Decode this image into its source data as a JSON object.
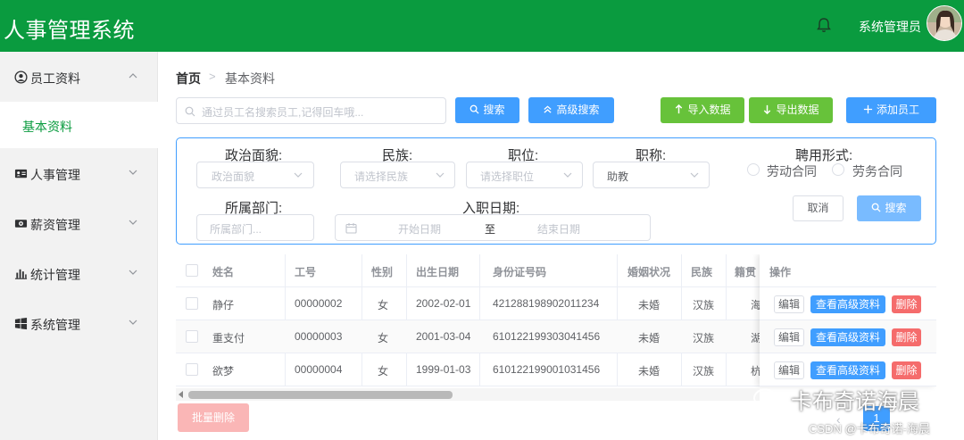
{
  "header": {
    "title": "人事管理系统",
    "user_name": "系统管理员"
  },
  "sidebar": {
    "items": [
      {
        "label": "员工资料",
        "icon": "user-circle-icon",
        "expanded": true,
        "children": [
          {
            "label": "基本资料"
          }
        ]
      },
      {
        "label": "人事管理",
        "icon": "id-card-icon"
      },
      {
        "label": "薪资管理",
        "icon": "money-icon"
      },
      {
        "label": "统计管理",
        "icon": "bar-chart-icon"
      },
      {
        "label": "系统管理",
        "icon": "windows-icon"
      }
    ]
  },
  "breadcrumb": {
    "home": "首页",
    "separator": ">",
    "current": "基本资料"
  },
  "toolbar": {
    "search_placeholder": "通过员工名搜索员工,记得回车哦...",
    "search_label": "搜索",
    "advanced_search_label": "高级搜索",
    "import_label": "导入数据",
    "export_label": "导出数据",
    "add_label": "添加员工"
  },
  "advanced": {
    "political_label": "政治面貌:",
    "political_placeholder": "政治面貌",
    "nation_label": "民族:",
    "nation_placeholder": "请选择民族",
    "position_label": "职位:",
    "position_placeholder": "请选择职位",
    "title_label": "职称:",
    "title_value": "助教",
    "employ_label": "聘用形式:",
    "employ_options": [
      "劳动合同",
      "劳务合同"
    ],
    "department_label": "所属部门:",
    "department_placeholder": "所属部门...",
    "date_label": "入职日期:",
    "date_start": "开始日期",
    "date_to": "至",
    "date_end": "结束日期",
    "cancel_label": "取消",
    "search_label": "搜索"
  },
  "table": {
    "headers": [
      "姓名",
      "工号",
      "性别",
      "出生日期",
      "身份证号码",
      "婚姻状况",
      "民族",
      "籍贯",
      "操作"
    ],
    "rows": [
      {
        "name": "静仔",
        "id": "00000002",
        "gender": "女",
        "birth": "2002-02-01",
        "idcard": "421288198902011234",
        "marriage": "未婚",
        "nation": "汉族",
        "native": "海"
      },
      {
        "name": "重支付",
        "id": "00000003",
        "gender": "女",
        "birth": "2001-03-04",
        "idcard": "610122199303041456",
        "marriage": "未婚",
        "nation": "汉族",
        "native": "湖"
      },
      {
        "name": "欲梦",
        "id": "00000004",
        "gender": "女",
        "birth": "1999-01-03",
        "idcard": "610122199001031456",
        "marriage": "未婚",
        "nation": "汉族",
        "native": "杭"
      }
    ],
    "actions": {
      "edit": "编辑",
      "view": "查看高级资料",
      "delete": "删除"
    }
  },
  "footer": {
    "batch_delete_label": "批量删除",
    "current_page": "1"
  },
  "watermark": {
    "main": "卡布奇诺海晨",
    "sub": "CSDN @卡布奇诺-海晨"
  },
  "colors": {
    "header": "#0a9b3f",
    "primary": "#409eff",
    "success": "#67c23a",
    "danger": "#f56c6c",
    "active_menu": "#0a9b3f"
  }
}
